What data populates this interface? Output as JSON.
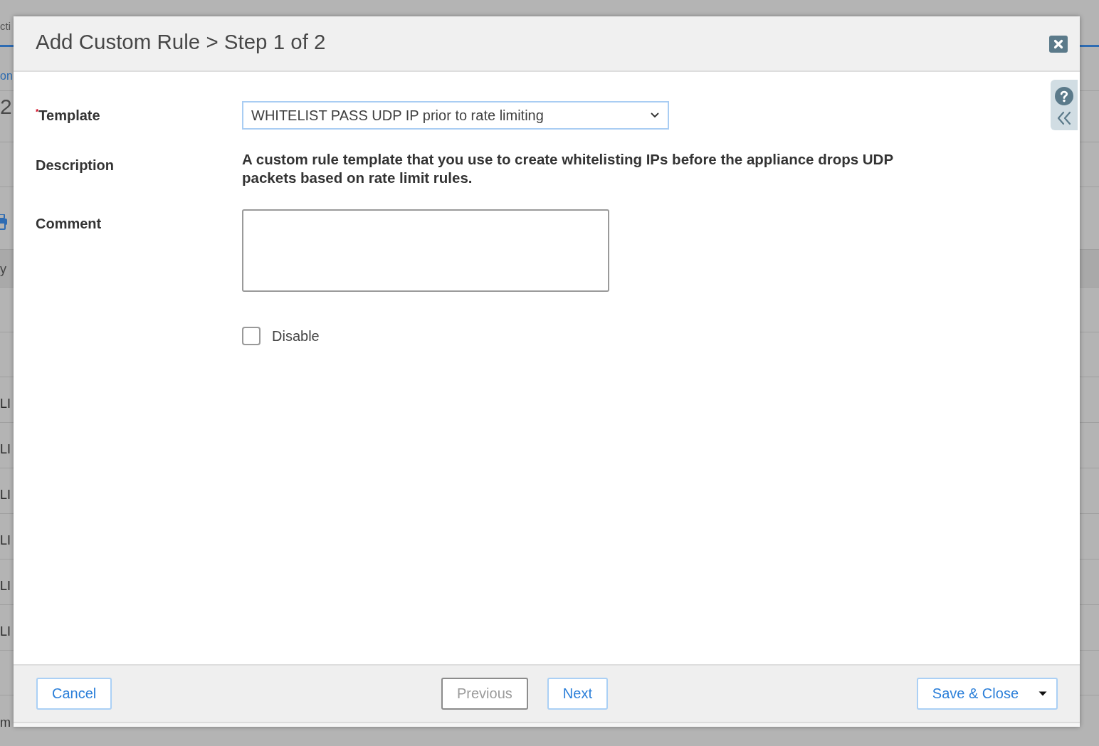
{
  "background": {
    "rows": [
      {
        "kind": "tab",
        "text": "cti"
      },
      {
        "kind": "link",
        "text": "on"
      },
      {
        "kind": "count",
        "text": "2"
      },
      {
        "kind": "blank"
      },
      {
        "kind": "toolbar"
      },
      {
        "kind": "header",
        "text": "y"
      },
      {
        "kind": "blank"
      },
      {
        "kind": "blank"
      },
      {
        "kind": "row",
        "text": "LI"
      },
      {
        "kind": "row",
        "text": "LI"
      },
      {
        "kind": "row",
        "text": "LI"
      },
      {
        "kind": "row",
        "text": "LI"
      },
      {
        "kind": "row",
        "text": "LI"
      },
      {
        "kind": "row",
        "text": "LI"
      },
      {
        "kind": "blank"
      },
      {
        "kind": "footer",
        "text": "m"
      }
    ]
  },
  "dialog": {
    "title": "Add Custom Rule > Step 1 of 2",
    "fields": [
      {
        "kind": "select",
        "label": "$^{*}$Template",
        "value": "WHITELIST PASS UDP IP prior to rate limiting"
      },
      {
        "kind": "text",
        "label": "Description",
        "value": "A custom rule template that you use to create whitelisting IPs before the appliance drops UDP packets based on rate limit rules."
      },
      {
        "kind": "textarea",
        "label": "Comment"
      },
      {
        "kind": "checkbox",
        "label": "Disable",
        "checked": false
      }
    ],
    "footer": {
      "left": [
        {
          "label": "Cancel",
          "disabled": false
        }
      ],
      "center": [
        {
          "label": "Previous",
          "disabled": true
        },
        {
          "label": "Next",
          "disabled": false
        }
      ],
      "right": [
        {
          "label": "Save & Close",
          "disabled": false,
          "has_menu": true
        }
      ]
    }
  }
}
